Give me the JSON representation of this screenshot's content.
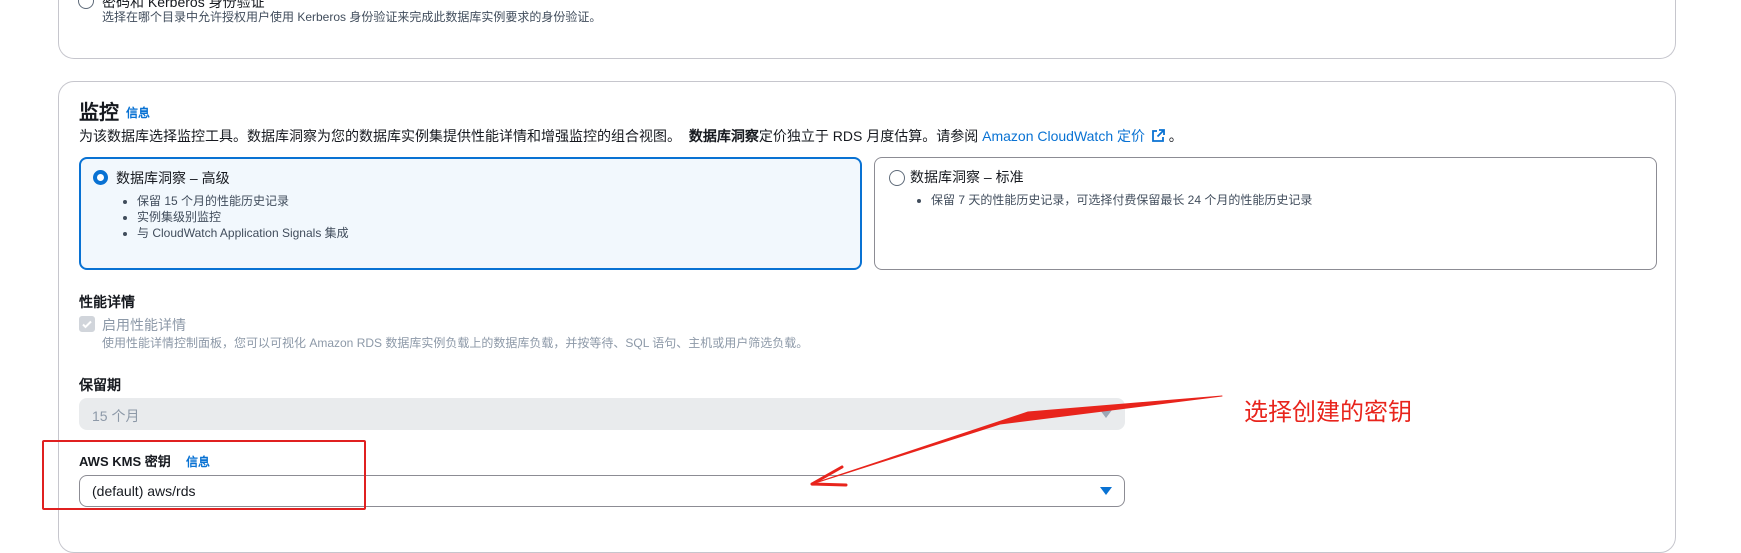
{
  "auth_section": {
    "option_label": "密码和 Kerberos 身份验证",
    "option_desc": "选择在哪个目录中允许授权用户使用 Kerberos 身份验证来完成此数据库实例要求的身份验证。"
  },
  "monitoring": {
    "title": "监控",
    "info": "信息",
    "desc_prefix": "为该数据库选择监控工具。数据库洞察为您的数据库实例集提供性能详情和增强监控的组合视图。",
    "desc_bold": "数据库洞察",
    "desc_mid": "定价独立于 RDS 月度估算。请参阅",
    "desc_link": "Amazon CloudWatch 定价",
    "desc_end": "。",
    "options": [
      {
        "label": "数据库洞察 – 高级",
        "selected": true,
        "bullets": [
          "保留 15 个月的性能历史记录",
          "实例集级别监控",
          "与 CloudWatch Application Signals 集成"
        ]
      },
      {
        "label": "数据库洞察 – 标准",
        "selected": false,
        "bullets": [
          "保留 7 天的性能历史记录，可选择付费保留最长 24 个月的性能历史记录"
        ]
      }
    ]
  },
  "performance": {
    "heading": "性能详情",
    "checkbox_label": "启用性能详情",
    "checkbox_desc": "使用性能详情控制面板，您可以可视化 Amazon RDS 数据库实例负载上的数据库负载，并按等待、SQL 语句、主机或用户筛选负载。",
    "checked": true,
    "disabled": true
  },
  "retention": {
    "label": "保留期",
    "value": "15 个月"
  },
  "kms": {
    "label": "AWS KMS 密钥",
    "info": "信息",
    "value": "(default) aws/rds"
  },
  "annotation": {
    "text": "选择创建的密钥",
    "color": "#e8241c"
  },
  "colors": {
    "accent": "#0972d3",
    "selected_bg": "#f2f8fd",
    "disabled_bg": "#e9ebed"
  }
}
